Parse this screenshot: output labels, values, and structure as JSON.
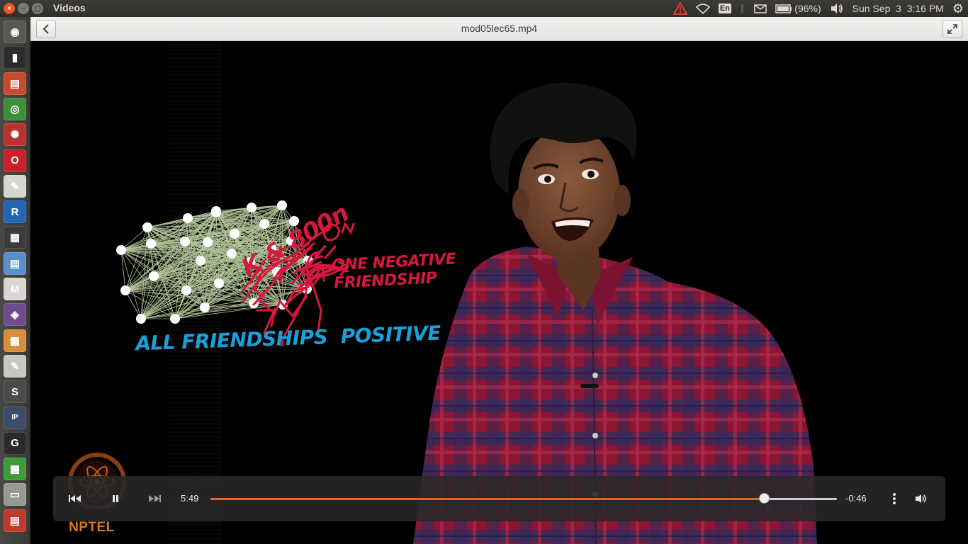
{
  "app": {
    "title": "Videos"
  },
  "panel": {
    "lang": "En",
    "battery": "(96%)",
    "clock": "Sun Sep  3  3:16 PM"
  },
  "headerbar": {
    "video_title": "mod05lec65.mp4"
  },
  "overlay": {
    "annotation_red_1": "ONE NEGATIVE",
    "annotation_red_2": "FRIENDSHIP",
    "annotation_red_scribble": "K & 800n",
    "annotation_blue": "ALL FRIENDSHIPS  POSITIVE",
    "logo_text": "NPTEL"
  },
  "player": {
    "elapsed": "5:49",
    "remaining": "-0:46",
    "progress": 0.883
  },
  "launcher": {
    "items": [
      {
        "name": "dash",
        "glyph": "◉",
        "color": "#5a5955"
      },
      {
        "name": "terminal",
        "glyph": "▮",
        "color": "#2c2c2c"
      },
      {
        "name": "files",
        "glyph": "▤",
        "color": "#c74a2f"
      },
      {
        "name": "chrome",
        "glyph": "◎",
        "color": "#3d8f3a"
      },
      {
        "name": "settings-app",
        "glyph": "✺",
        "color": "#b8332d"
      },
      {
        "name": "opera",
        "glyph": "O",
        "color": "#c9202c"
      },
      {
        "name": "pdf-viewer",
        "glyph": "✎",
        "color": "#d7d5cf"
      },
      {
        "name": "r-lang",
        "glyph": "R",
        "color": "#2166b3"
      },
      {
        "name": "video-editor",
        "glyph": "▦",
        "color": "#3b3b3b"
      },
      {
        "name": "document-viewer",
        "glyph": "▤",
        "color": "#5a8fc9"
      },
      {
        "name": "gmail",
        "glyph": "M",
        "color": "#d9d6d0"
      },
      {
        "name": "media-player",
        "glyph": "◈",
        "color": "#6e4d8f"
      },
      {
        "name": "impress",
        "glyph": "▦",
        "color": "#d88f3a"
      },
      {
        "name": "text-editor",
        "glyph": "✎",
        "color": "#c8c6c0"
      },
      {
        "name": "sublime",
        "glyph": "S",
        "color": "#4a4a4a"
      },
      {
        "name": "ipython",
        "glyph": "IP",
        "color": "#3a4c6a"
      },
      {
        "name": "gephi",
        "glyph": "G",
        "color": "#2a2a2a"
      },
      {
        "name": "calc",
        "glyph": "▦",
        "color": "#3f9a3a"
      },
      {
        "name": "drive",
        "glyph": "▭",
        "color": "#9a9894"
      },
      {
        "name": "trash",
        "glyph": "▤",
        "color": "#c0392b"
      }
    ]
  }
}
